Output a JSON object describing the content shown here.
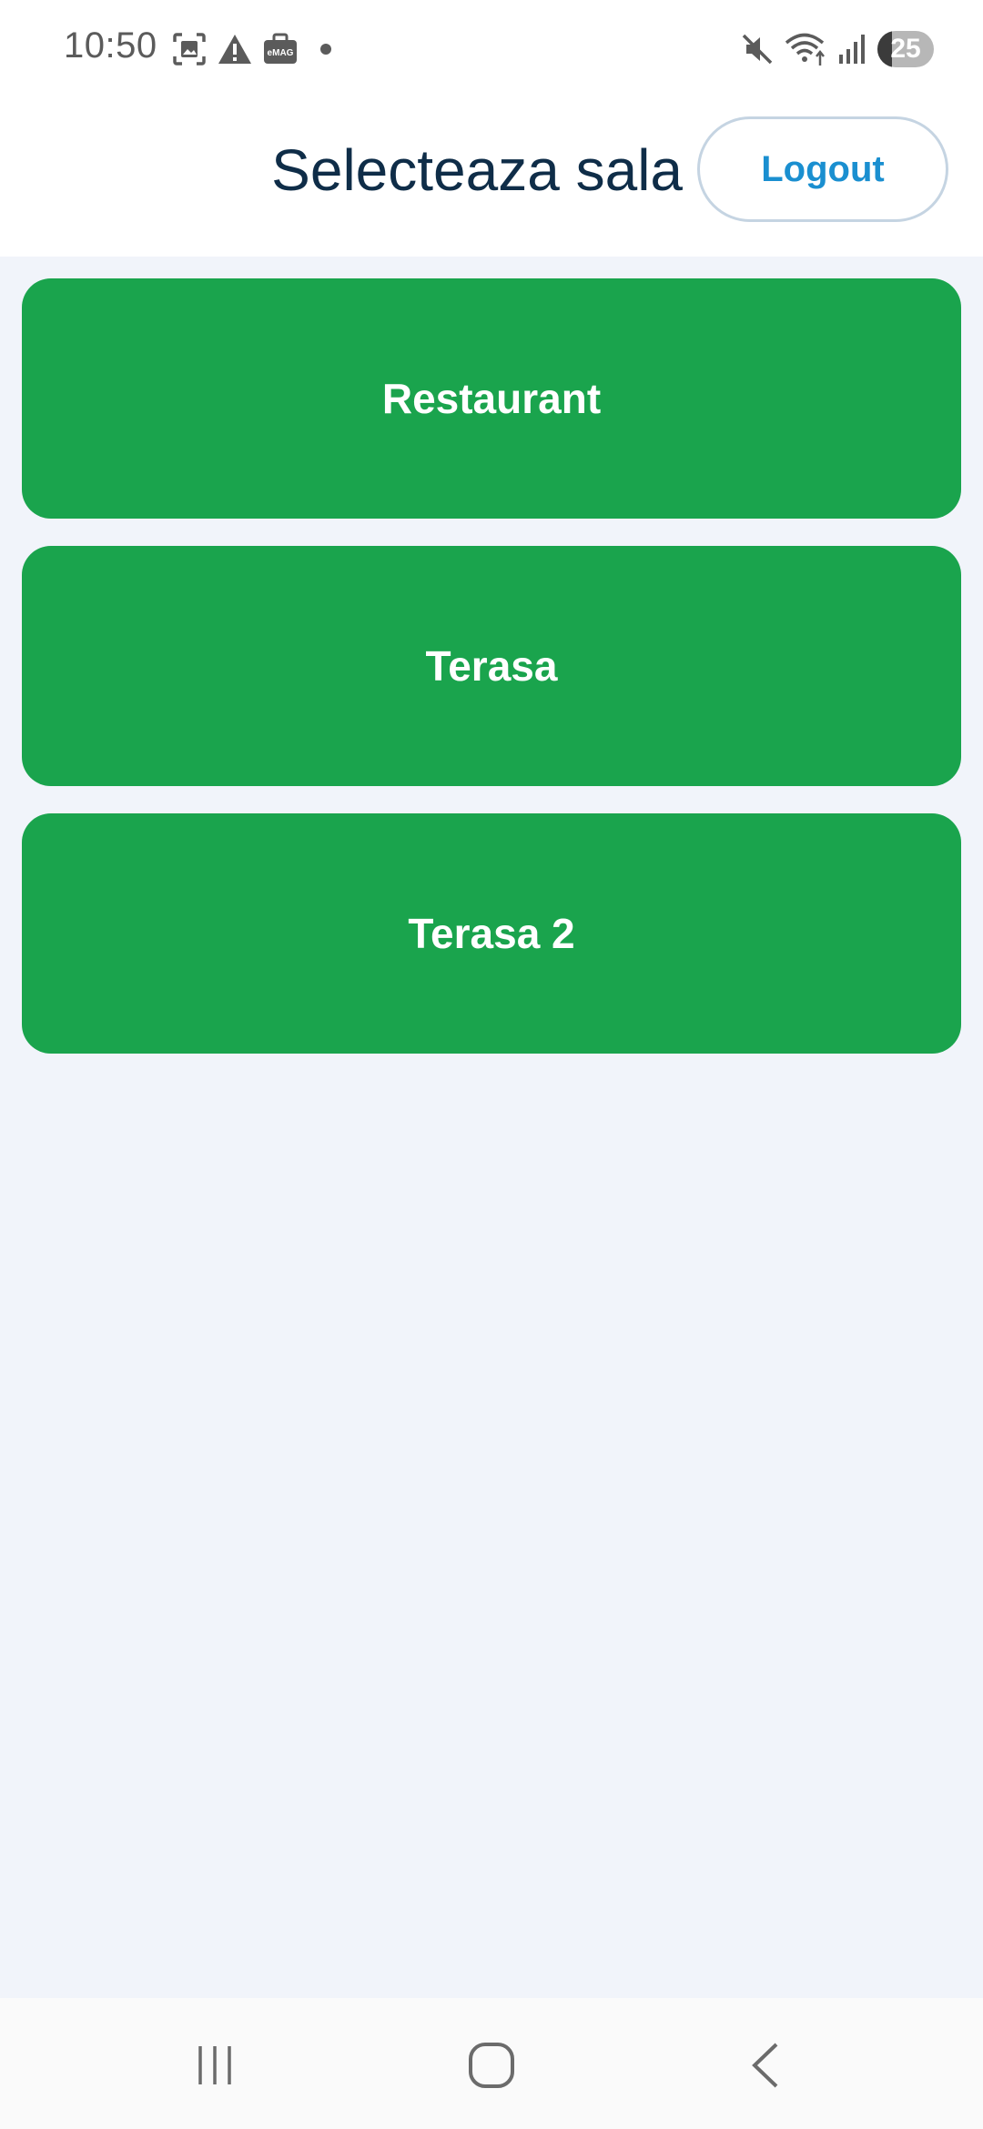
{
  "status_bar": {
    "time": "10:50",
    "battery_level": "25",
    "battery_fraction": 0.25,
    "left_icons": [
      "screenshot-icon",
      "warning-icon",
      "emag-icon",
      "notification-dot"
    ],
    "right_icons": [
      "mute-icon",
      "wifi-icon",
      "signal-icon",
      "battery-icon"
    ]
  },
  "header": {
    "title": "Selecteaza sala",
    "logout_label": "Logout"
  },
  "rooms": [
    {
      "label": "Restaurant"
    },
    {
      "label": "Terasa"
    },
    {
      "label": "Terasa 2"
    }
  ],
  "navigation": {
    "icons": [
      "recent-apps-icon",
      "home-icon",
      "back-icon"
    ]
  },
  "colors": {
    "accent": "#1aa44d",
    "title": "#0f2d48",
    "logout_text": "#1a8fd0",
    "background": "#f1f4fa"
  }
}
